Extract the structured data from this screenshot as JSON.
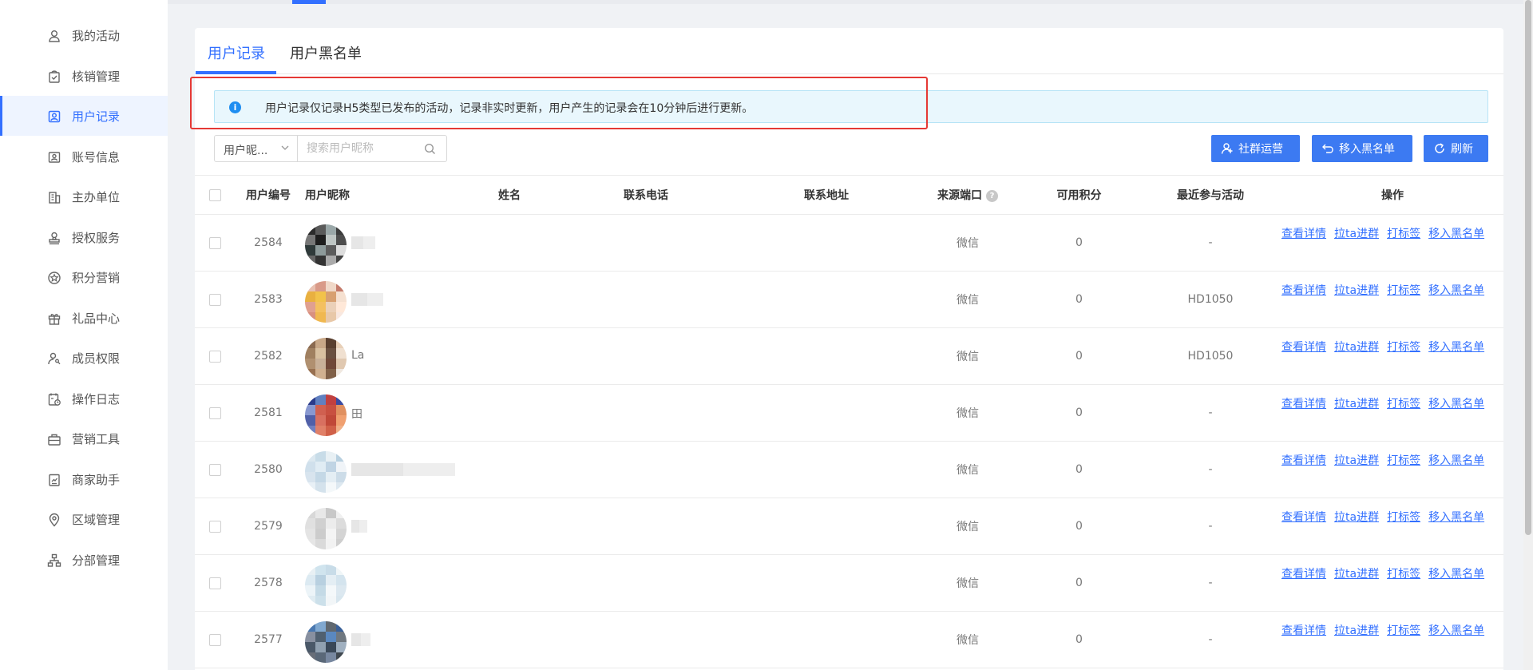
{
  "sidebar": {
    "items": [
      {
        "label": "我的活动",
        "icon": "user-icon"
      },
      {
        "label": "核销管理",
        "icon": "check-bag-icon"
      },
      {
        "label": "用户记录",
        "icon": "user-record-icon",
        "active": true
      },
      {
        "label": "账号信息",
        "icon": "account-icon"
      },
      {
        "label": "主办单位",
        "icon": "building-icon"
      },
      {
        "label": "授权服务",
        "icon": "stamp-icon"
      },
      {
        "label": "积分营销",
        "icon": "star-circle-icon"
      },
      {
        "label": "礼品中心",
        "icon": "gift-icon"
      },
      {
        "label": "成员权限",
        "icon": "member-key-icon"
      },
      {
        "label": "操作日志",
        "icon": "log-icon"
      },
      {
        "label": "营销工具",
        "icon": "toolbox-icon"
      },
      {
        "label": "商家助手",
        "icon": "assistant-icon"
      },
      {
        "label": "区域管理",
        "icon": "location-icon"
      },
      {
        "label": "分部管理",
        "icon": "org-chart-icon"
      }
    ]
  },
  "tabs": [
    {
      "label": "用户记录",
      "active": true
    },
    {
      "label": "用户黑名单",
      "active": false
    }
  ],
  "notice": {
    "text": "用户记录仅记录H5类型已发布的活动，记录非实时更新，用户产生的记录会在10分钟后进行更新。"
  },
  "filter": {
    "select_value": "用户昵...",
    "search_placeholder": "搜索用户昵称"
  },
  "buttons": {
    "community": "社群运营",
    "blacklist": "移入黑名单",
    "refresh": "刷新"
  },
  "table": {
    "columns": [
      "用户编号",
      "用户昵称",
      "姓名",
      "联系电话",
      "联系地址",
      "来源端口",
      "可用积分",
      "最近参与活动",
      "操作"
    ],
    "rows": [
      {
        "id": "2584",
        "nickname": "",
        "source": "微信",
        "points": "0",
        "recent": "-"
      },
      {
        "id": "2583",
        "nickname": "",
        "source": "微信",
        "points": "0",
        "recent": "HD1050"
      },
      {
        "id": "2582",
        "nickname": "La",
        "source": "微信",
        "points": "0",
        "recent": "HD1050"
      },
      {
        "id": "2581",
        "nickname": "田",
        "source": "微信",
        "points": "0",
        "recent": "-"
      },
      {
        "id": "2580",
        "nickname": "",
        "source": "微信",
        "points": "0",
        "recent": "-"
      },
      {
        "id": "2579",
        "nickname": "",
        "source": "微信",
        "points": "0",
        "recent": "-"
      },
      {
        "id": "2578",
        "nickname": "",
        "source": "微信",
        "points": "0",
        "recent": "-"
      },
      {
        "id": "2577",
        "nickname": "",
        "source": "微信",
        "points": "0",
        "recent": "-"
      }
    ],
    "actions": [
      "查看详情",
      "拉ta进群",
      "打标签",
      "移入黑名单"
    ]
  },
  "colors": {
    "accent": "#3370ff",
    "button": "#3c7af2",
    "notice_bg": "#e9f7fd",
    "highlight_box": "#e53935"
  }
}
